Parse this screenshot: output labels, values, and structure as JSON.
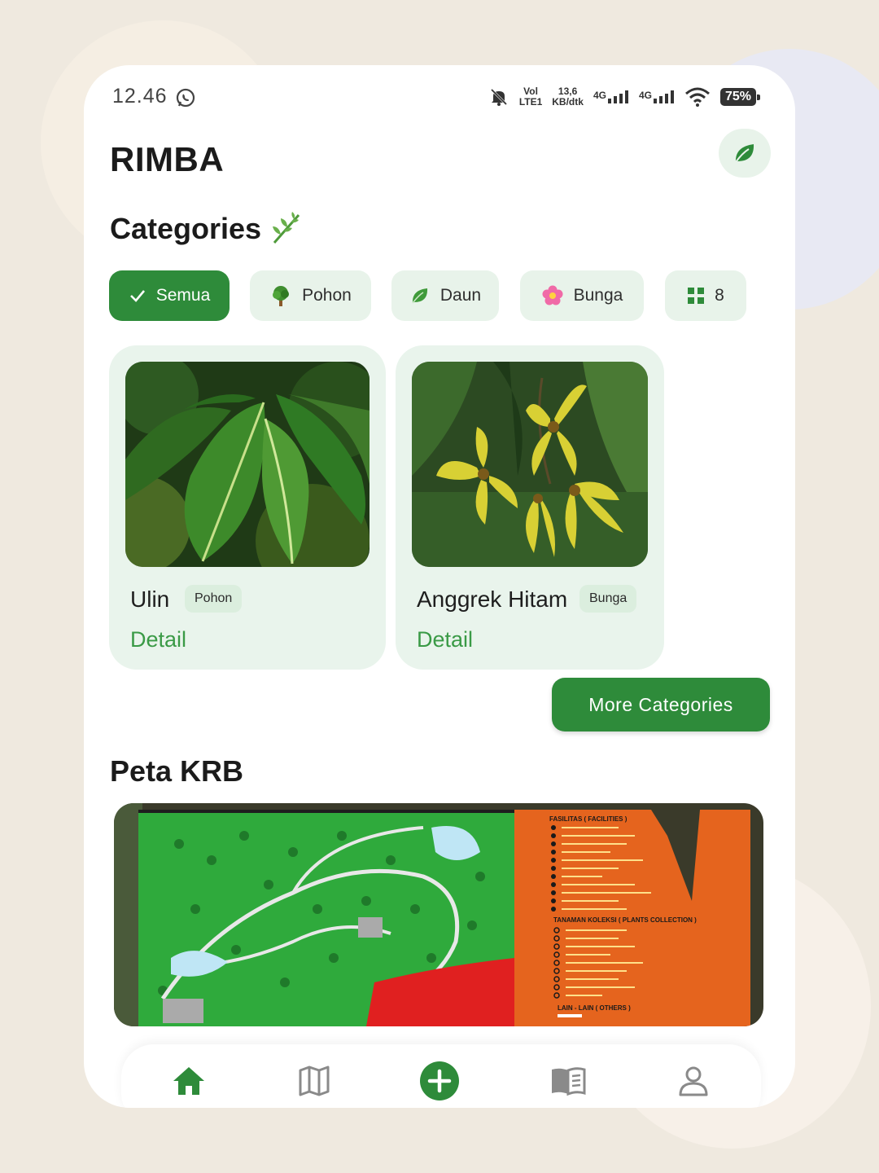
{
  "status_bar": {
    "time": "12.46",
    "net_top": "Vol",
    "net_bottom": "LTE1",
    "speed_value": "13,6",
    "speed_unit": "KB/dtk",
    "sim1": "4G",
    "sim2": "4G",
    "battery": "75%"
  },
  "app": {
    "title": "RIMBA",
    "accent": "#2e8b3a"
  },
  "categories": {
    "title": "Categories",
    "chips": [
      {
        "label": "Semua",
        "icon": "check-icon",
        "active": true
      },
      {
        "label": "Pohon",
        "icon": "tree-icon",
        "active": false
      },
      {
        "label": "Daun",
        "icon": "leaf-icon",
        "active": false
      },
      {
        "label": "Bunga",
        "icon": "flower-icon",
        "active": false
      },
      {
        "label": "8",
        "icon": "grid-icon",
        "active": false
      }
    ]
  },
  "plants": [
    {
      "name": "Ulin",
      "tag": "Pohon",
      "action": "Detail"
    },
    {
      "name": "Anggrek Hitam",
      "tag": "Bunga",
      "action": "Detail"
    }
  ],
  "more_button": "More Categories",
  "map_section": {
    "title": "Peta KRB",
    "legend_heading_1": "FASILITAS ( FACILITIES )",
    "legend_heading_2": "TANAMAN KOLEKSI ( PLANTS COLLECTION )",
    "legend_heading_3": "LAIN - LAIN ( OTHERS )"
  },
  "bottom_nav": [
    {
      "icon": "home-icon",
      "active": true
    },
    {
      "icon": "map-icon",
      "active": false
    },
    {
      "icon": "add-icon",
      "active": false
    },
    {
      "icon": "book-icon",
      "active": false
    },
    {
      "icon": "profile-icon",
      "active": false
    }
  ]
}
